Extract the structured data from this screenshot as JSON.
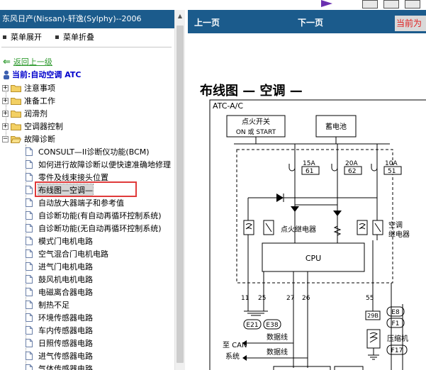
{
  "window": {
    "title": "东风日产(Nissan)-轩逸(Sylphy)--2006"
  },
  "menu": {
    "expand_label": "菜单展开",
    "collapse_label": "菜单折叠"
  },
  "tree": {
    "back_label": "返回上一级",
    "current_label": "当前:自动空调 ATC",
    "folders": [
      {
        "label": "注意事项",
        "state": "+"
      },
      {
        "label": "准备工作",
        "state": "+"
      },
      {
        "label": "润滑剂",
        "state": "+"
      },
      {
        "label": "空调器控制",
        "state": "+"
      },
      {
        "label": "故障诊断",
        "state": "-"
      }
    ],
    "items": [
      {
        "label": "CONSULT—II诊断仪功能(BCM)"
      },
      {
        "label": "如何进行故障诊断以便快速准确地修理"
      },
      {
        "label": "零件及线束接头位置"
      },
      {
        "label": "布线图—空调—"
      },
      {
        "label": "自动放大器端子和参考值"
      },
      {
        "label": "自诊断功能(有自动再循环控制系统)"
      },
      {
        "label": "自诊断功能(无自动再循环控制系统)"
      },
      {
        "label": "模式门电机电路"
      },
      {
        "label": "空气混合门电机电路"
      },
      {
        "label": "进气门电机电路"
      },
      {
        "label": "鼓风机电机电路"
      },
      {
        "label": "电磁离合器电路"
      },
      {
        "label": "制热不足"
      },
      {
        "label": "环境传感器电路"
      },
      {
        "label": "车内传感器电路"
      },
      {
        "label": "日照传感器电路"
      },
      {
        "label": "进气传感器电路"
      },
      {
        "label": "气体传感器电路"
      }
    ],
    "selected_index": 3
  },
  "nav": {
    "prev_label": "上一页",
    "next_label": "下一页",
    "current_label": "当前为"
  },
  "content": {
    "heading": "布线图 — 空调 —"
  },
  "diagram": {
    "code": "ATC-A/C",
    "ignition_label_1": "点火开关",
    "ignition_label_2": "ON 或 START",
    "battery_label": "蓄电池",
    "fuses": [
      {
        "amp": "15A",
        "num": "61"
      },
      {
        "amp": "20A",
        "num": "62"
      },
      {
        "amp": "10A",
        "num": "51"
      }
    ],
    "ignition_relay": "点火继电器",
    "ac_relay_1": "空调",
    "ac_relay_2": "继电器",
    "cpu": "CPU",
    "pins": [
      "11",
      "25",
      "27",
      "26",
      "55"
    ],
    "connectors": [
      "E21",
      "E38",
      "E8",
      "F1",
      "F17"
    ],
    "block_num": "29B",
    "data_line": "数据线",
    "can_label_1": "至 CAN",
    "can_label_2": "系统",
    "compressor": "压缩机"
  }
}
